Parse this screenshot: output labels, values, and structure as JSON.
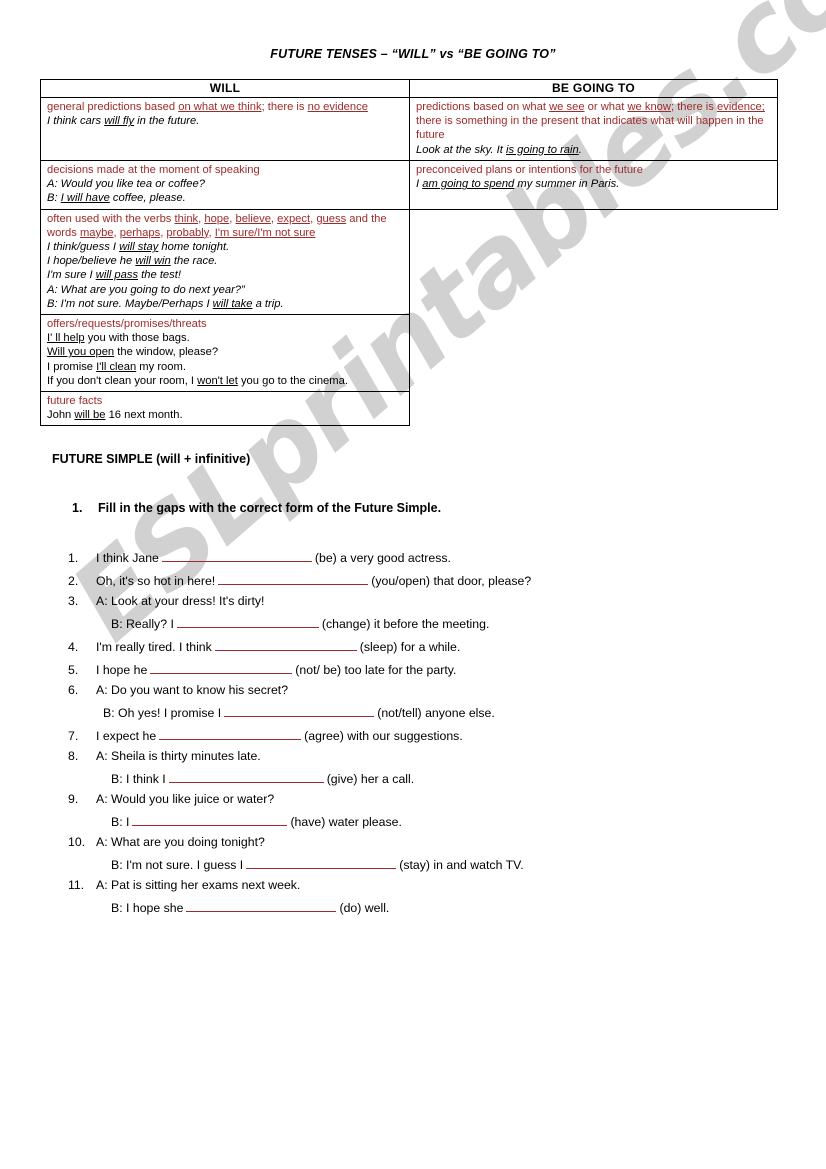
{
  "watermark": {
    "text": "ESLprintables.com"
  },
  "doc": {
    "title": "FUTURE TENSES – “WILL” vs “BE GOING TO”"
  },
  "table": {
    "headers": {
      "left": "WILL",
      "right": "BE GOING TO"
    },
    "rows": [
      {
        "left": {
          "rule": "general predictions based on what we think; there is no evidence",
          "rule_underlines": [
            "on what we think",
            "no evidence"
          ],
          "examples": [
            "I think cars will fly in the future."
          ],
          "example_underlines": [
            "will fly"
          ],
          "italic": true
        },
        "right": {
          "rule": "predictions based on what we see or what we know; there is evidence; there is something in the present that indicates what will happen in the future",
          "rule_underlines": [
            "we see",
            "we know",
            "evidence;"
          ],
          "examples": [
            "Look at the sky. It is going to rain."
          ],
          "example_underlines": [
            "is going to rain"
          ],
          "italic": true
        }
      },
      {
        "left": {
          "rule": "decisions made at the moment of speaking",
          "examples": [
            "A: Would you like tea or coffee?",
            "B: I will have coffee, please."
          ],
          "example_underlines": [
            "I will have"
          ],
          "italic": true
        },
        "right": {
          "rule": "preconceived plans or intentions for the future",
          "examples": [
            "I am going to spend my summer in Paris."
          ],
          "example_underlines": [
            "am going to spend"
          ],
          "italic": true
        }
      },
      {
        "left": {
          "rule": "often used with the verbs think, hope, believe, expect, guess and the words maybe, perhaps, probably, I'm sure/I'm not sure",
          "rule_underlines": [
            "think",
            "hope",
            "believe",
            "expect",
            "guess",
            "maybe",
            "perhaps",
            "probably",
            "I'm sure/I'm not sure"
          ],
          "examples": [
            "I think/guess I will stay home tonight.",
            "I hope/believe he will win the race.",
            "I'm sure I will pass the test!",
            "A: What are you going to do next year?”",
            "B: I'm not sure. Maybe/Perhaps I will take a trip."
          ],
          "example_underlines": [
            "will stay",
            "will win",
            "will pass",
            "will take"
          ],
          "italic": true
        },
        "right": null
      },
      {
        "left": {
          "rule": "offers/requests/promises/threats",
          "examples": [
            "I' ll help you with those bags.",
            "Will you open the window, please?",
            "I promise I'll clean my room.",
            "If you don't clean your room, I won't let you go to the cinema."
          ],
          "example_underlines": [
            "I' ll help",
            "Will you open",
            "I'll clean",
            "won't let"
          ],
          "italic": false
        },
        "right": null
      },
      {
        "left": {
          "rule": "future facts",
          "examples": [
            "John will be 16 next month."
          ],
          "example_underlines": [
            "will be"
          ],
          "italic": false
        },
        "right": null
      }
    ]
  },
  "section": {
    "heading": "FUTURE SIMPLE (will + infinitive)",
    "instruction_number": "1.",
    "instruction": "Fill in the gaps with the correct form of the Future Simple."
  },
  "exercises": [
    {
      "number": "1.",
      "lines": [
        {
          "prefix": "I think Jane",
          "gap_width": 150,
          "suffix": "(be) a very good actress."
        }
      ]
    },
    {
      "number": "2.",
      "lines": [
        {
          "prefix": "Oh, it's so hot in here!",
          "gap_width": 150,
          "suffix": "(you/open) that door, please?"
        }
      ]
    },
    {
      "number": "3.",
      "lines": [
        {
          "prefix": "A: Look at your dress! It's dirty!",
          "gap_width": 0,
          "suffix": ""
        },
        {
          "sub": true,
          "prefix": "B: Really? I",
          "gap_width": 142,
          "suffix": "(change) it before the meeting."
        }
      ]
    },
    {
      "number": "4.",
      "lines": [
        {
          "prefix": "I'm really tired. I think",
          "gap_width": 142,
          "suffix": "(sleep) for a while."
        }
      ]
    },
    {
      "number": "5.",
      "lines": [
        {
          "prefix": "I hope he",
          "gap_width": 142,
          "suffix": "(not/ be) too late for the party."
        }
      ]
    },
    {
      "number": "6.",
      "lines": [
        {
          "prefix": "A: Do you want to know his secret?",
          "gap_width": 0,
          "suffix": ""
        },
        {
          "sub": true,
          "tight": true,
          "prefix": "B: Oh yes! I promise I",
          "gap_width": 150,
          "suffix": "(not/tell) anyone else."
        }
      ]
    },
    {
      "number": "7.",
      "lines": [
        {
          "prefix": "I expect he",
          "gap_width": 142,
          "suffix": "(agree) with our suggestions."
        }
      ]
    },
    {
      "number": "8.",
      "lines": [
        {
          "prefix": "A: Sheila is thirty minutes late.",
          "gap_width": 0,
          "suffix": ""
        },
        {
          "sub": true,
          "prefix": "B: I think I",
          "gap_width": 155,
          "suffix": "(give) her a call."
        }
      ]
    },
    {
      "number": "9.",
      "lines": [
        {
          "prefix": "A: Would you like juice or water?",
          "gap_width": 0,
          "suffix": ""
        },
        {
          "sub": true,
          "prefix": "B: I",
          "gap_width": 155,
          "suffix": "(have) water please."
        }
      ]
    },
    {
      "number": "10.",
      "lines": [
        {
          "prefix": "A: What are you doing tonight?",
          "gap_width": 0,
          "suffix": ""
        },
        {
          "sub": true,
          "prefix": "B: I'm not sure. I guess I",
          "gap_width": 150,
          "suffix": "(stay) in and watch TV."
        }
      ]
    },
    {
      "number": "11.",
      "lines": [
        {
          "prefix": " A: Pat is sitting her exams next week.",
          "gap_width": 0,
          "suffix": ""
        },
        {
          "sub": true,
          "prefix": "B: I hope she",
          "gap_width": 150,
          "suffix": "(do) well."
        }
      ]
    }
  ],
  "colors": {
    "rule_red": "#9d2b2b",
    "gap_line": "#9d2b2b",
    "watermark_gray": "#cfcfcf",
    "border": "#000000"
  }
}
